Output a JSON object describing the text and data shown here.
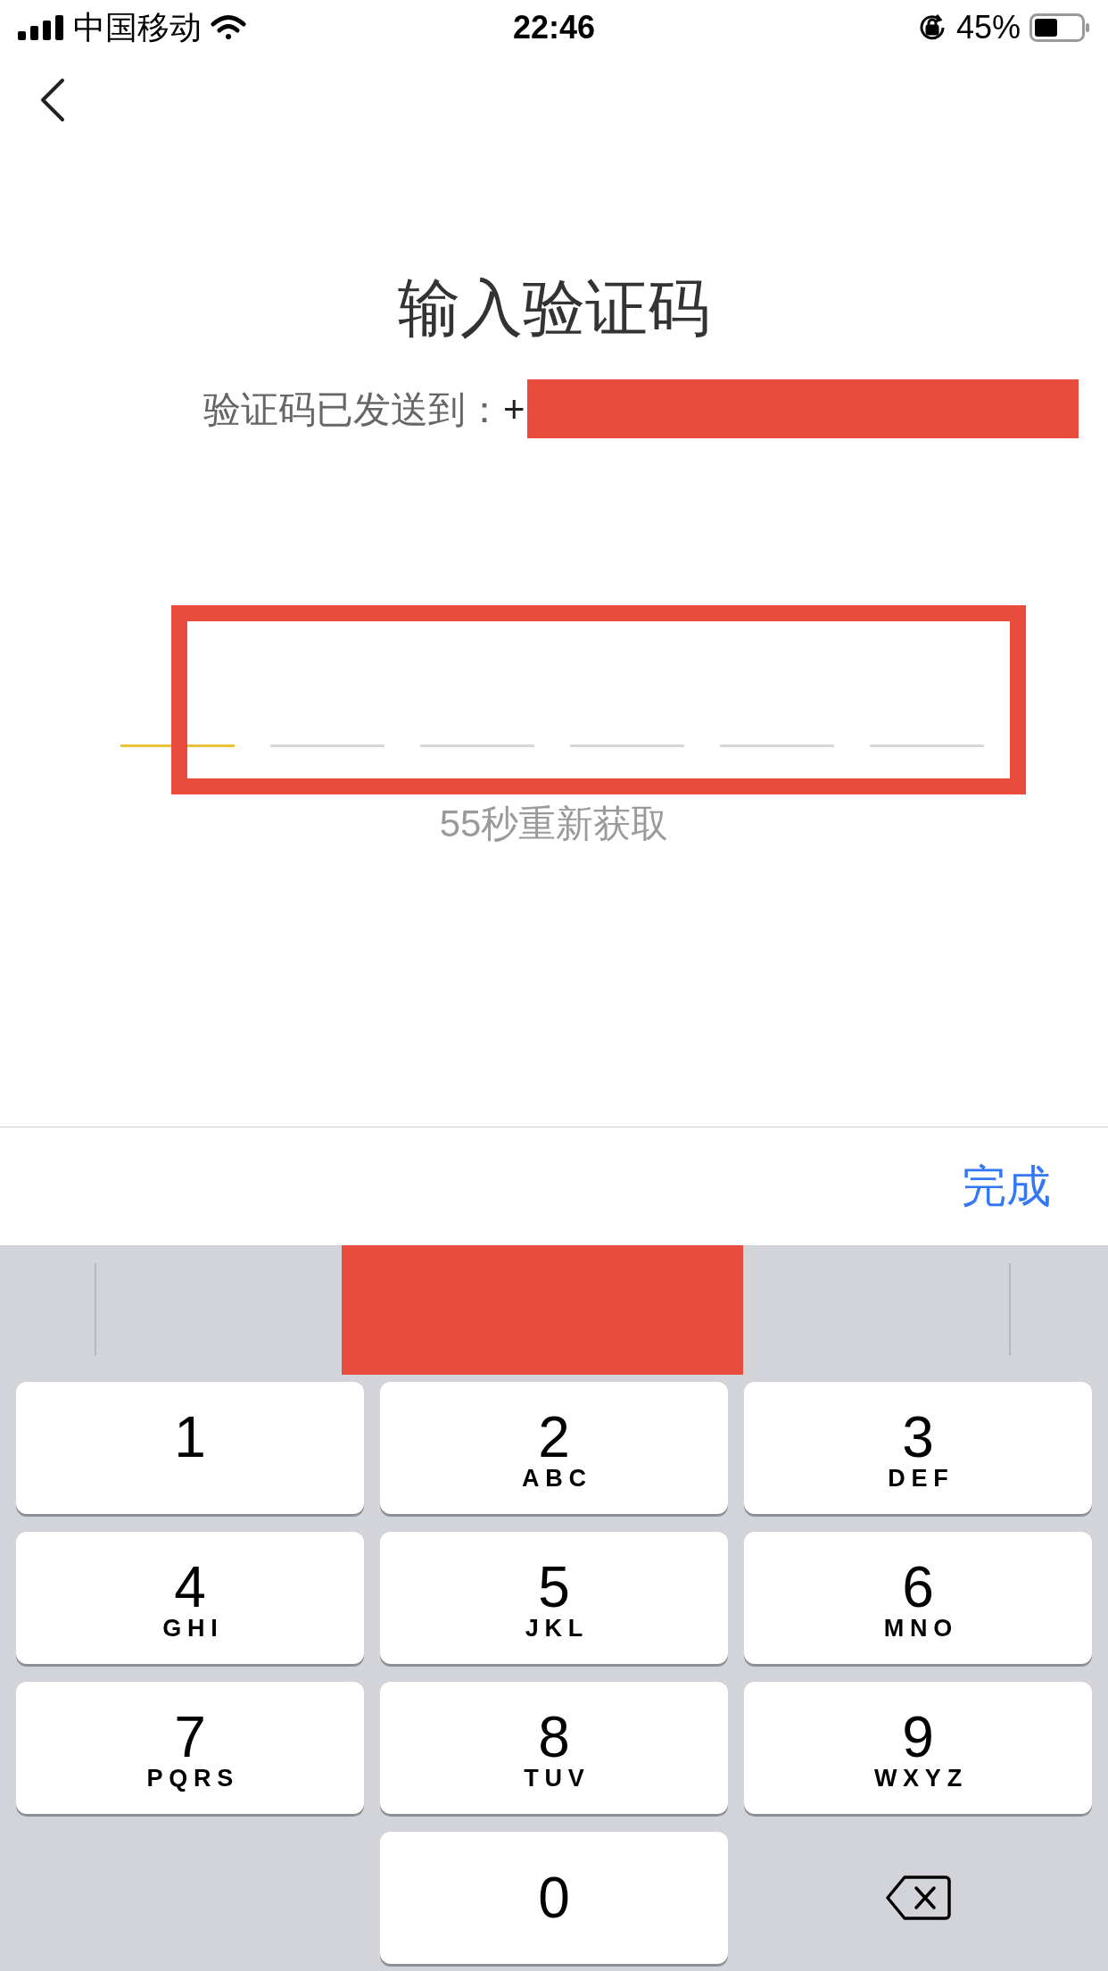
{
  "status_bar": {
    "carrier": "中国移动",
    "time": "22:46",
    "battery": "45%"
  },
  "title": "输入验证码",
  "subtitle": {
    "text": "验证码已发送到：",
    "number_prefix": "+"
  },
  "code_slots": [
    {
      "selected": true
    },
    {
      "selected": false
    },
    {
      "selected": false
    },
    {
      "selected": false
    },
    {
      "selected": false
    },
    {
      "selected": false
    }
  ],
  "countdown": "55秒重新获取",
  "done": "完成",
  "keys": [
    {
      "kind": "digit",
      "digit": "1"
    },
    {
      "kind": "digit",
      "digit": "2",
      "letters": "ABC"
    },
    {
      "kind": "digit",
      "digit": "3",
      "letters": "DEF"
    },
    {
      "kind": "digit",
      "digit": "4",
      "letters": "GHI"
    },
    {
      "kind": "digit",
      "digit": "5",
      "letters": "JKL"
    },
    {
      "kind": "digit",
      "digit": "6",
      "letters": "MNO"
    },
    {
      "kind": "digit",
      "digit": "7",
      "letters": "PQRS"
    },
    {
      "kind": "digit",
      "digit": "8",
      "letters": "TUV"
    },
    {
      "kind": "digit",
      "digit": "9",
      "letters": "WXYZ"
    },
    {
      "kind": "digit",
      "digit": "0"
    },
    {
      "kind": "delete"
    }
  ]
}
